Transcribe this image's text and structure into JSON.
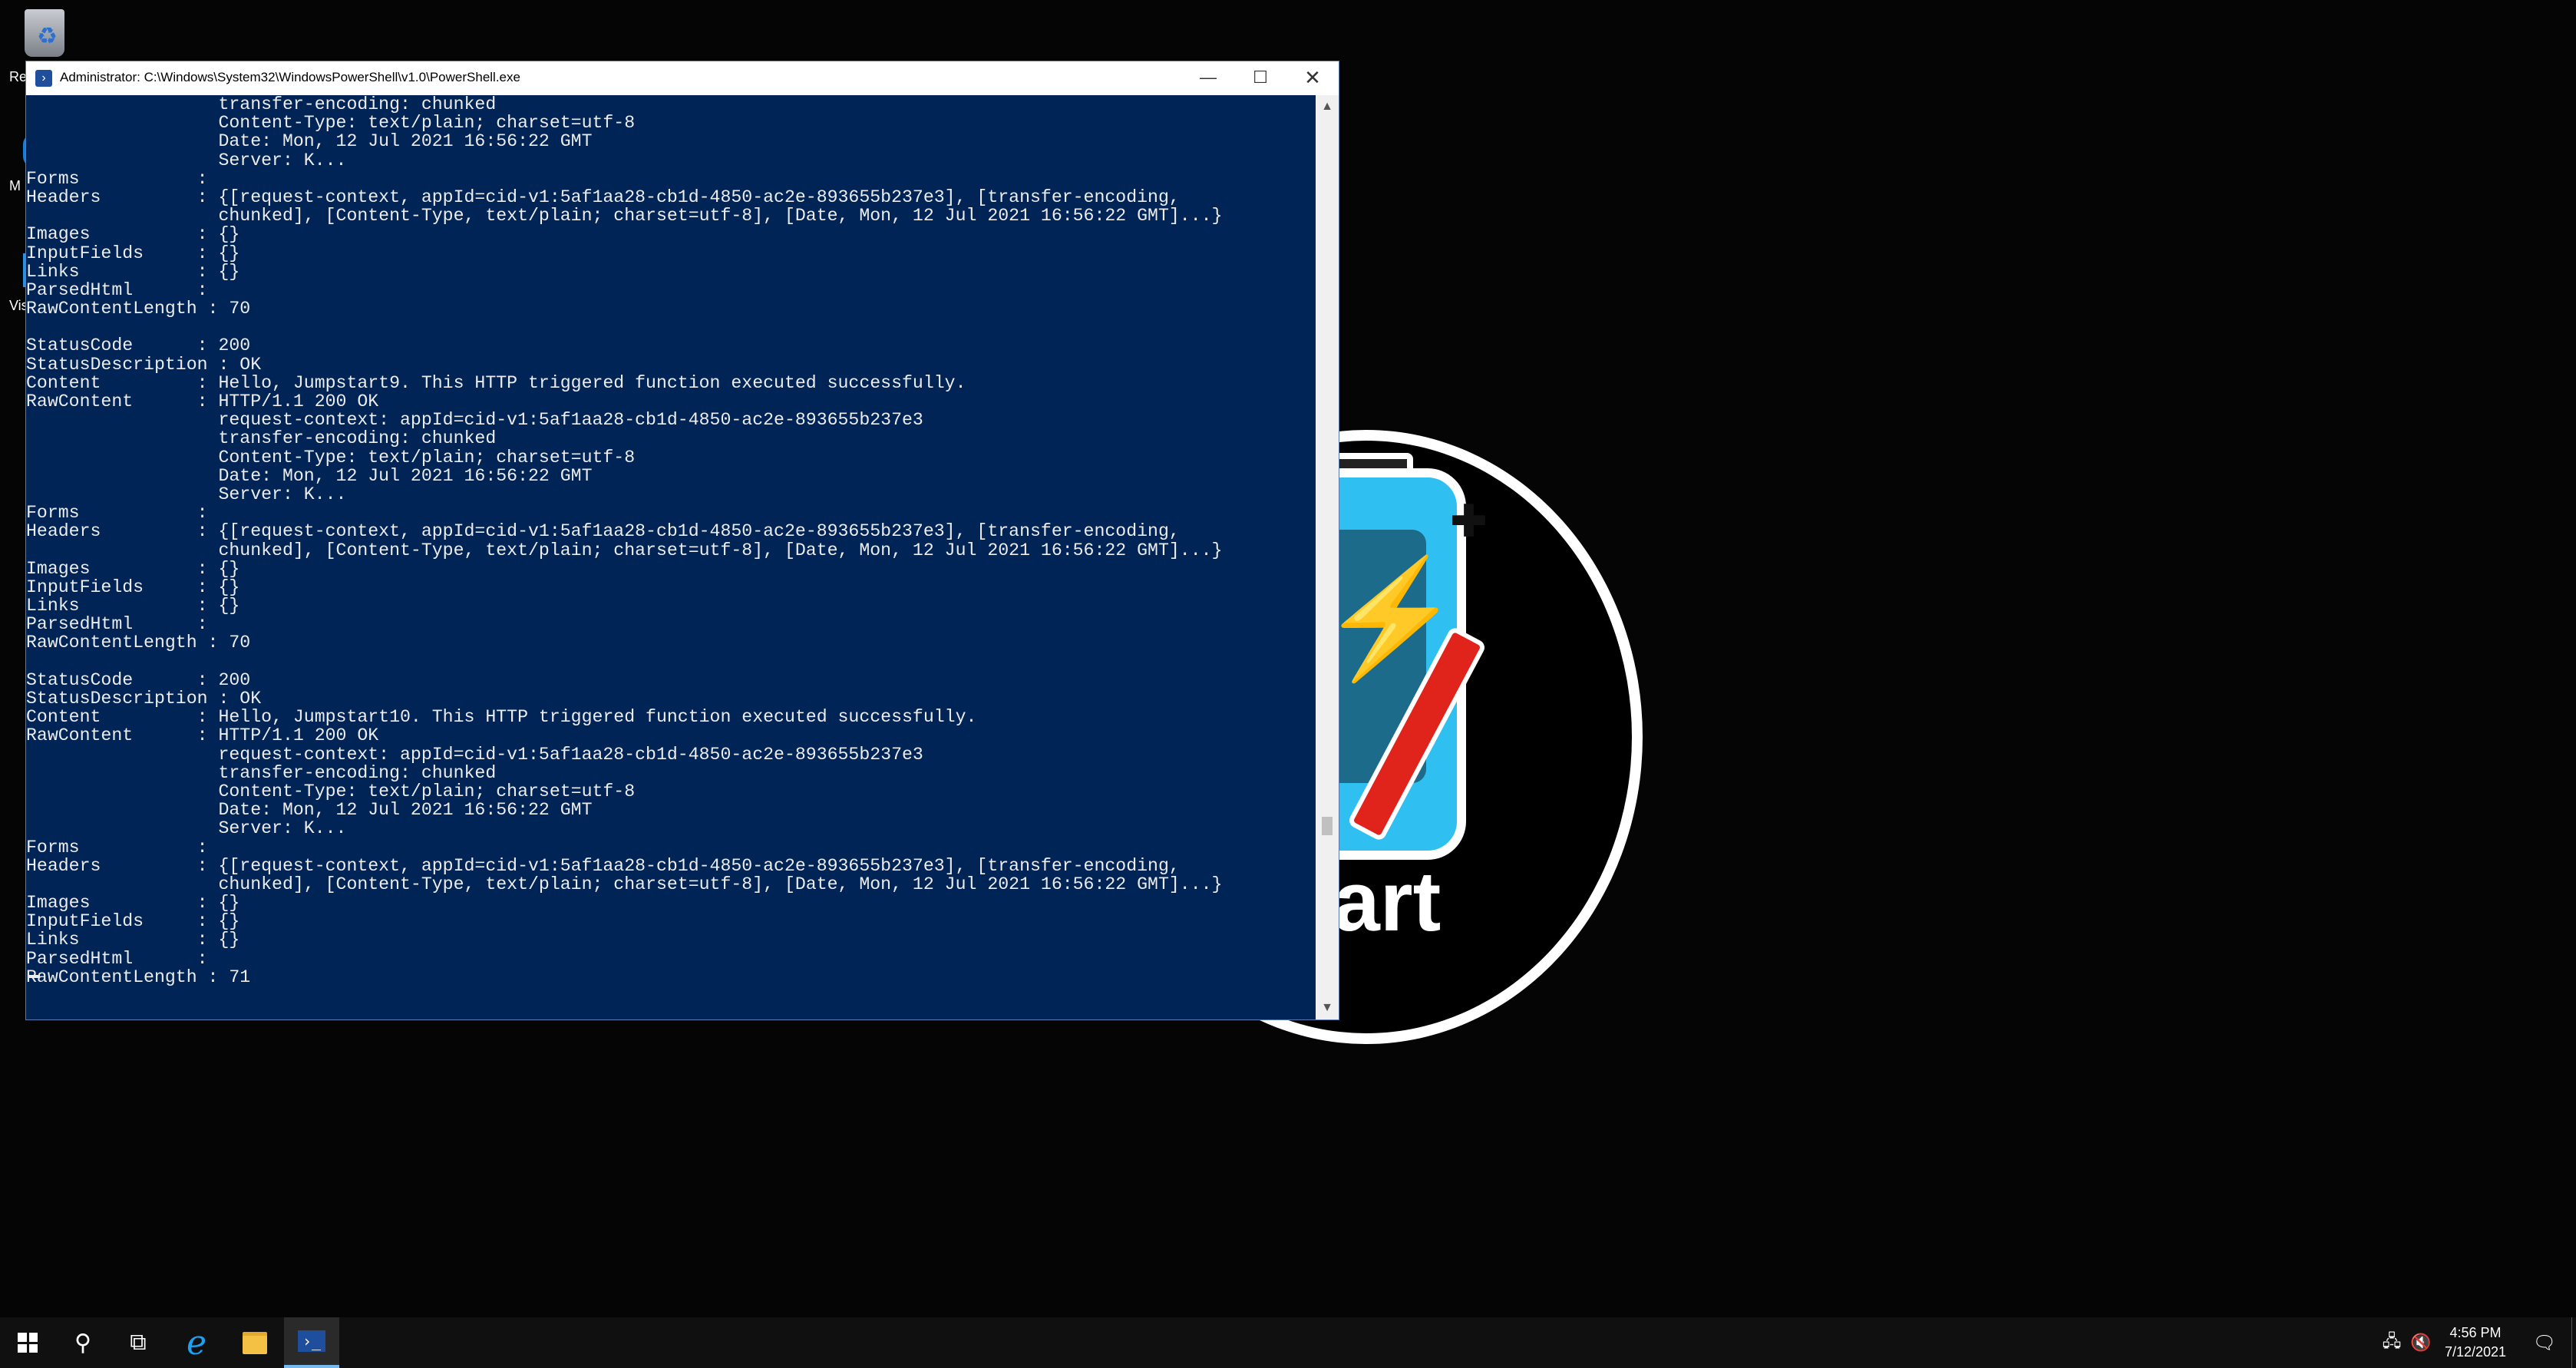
{
  "window": {
    "title": "Administrator: C:\\Windows\\System32\\WindowsPowerShell\\v1.0\\PowerShell.exe",
    "console_lines": [
      "                  transfer-encoding: chunked",
      "                  Content-Type: text/plain; charset=utf-8",
      "                  Date: Mon, 12 Jul 2021 16:56:22 GMT",
      "                  Server: K...",
      "Forms           :",
      "Headers         : {[request-context, appId=cid-v1:5af1aa28-cb1d-4850-ac2e-893655b237e3], [transfer-encoding,",
      "                  chunked], [Content-Type, text/plain; charset=utf-8], [Date, Mon, 12 Jul 2021 16:56:22 GMT]...}",
      "Images          : {}",
      "InputFields     : {}",
      "Links           : {}",
      "ParsedHtml      :",
      "RawContentLength : 70",
      "",
      "StatusCode      : 200",
      "StatusDescription : OK",
      "Content         : Hello, Jumpstart9. This HTTP triggered function executed successfully.",
      "RawContent      : HTTP/1.1 200 OK",
      "                  request-context: appId=cid-v1:5af1aa28-cb1d-4850-ac2e-893655b237e3",
      "                  transfer-encoding: chunked",
      "                  Content-Type: text/plain; charset=utf-8",
      "                  Date: Mon, 12 Jul 2021 16:56:22 GMT",
      "                  Server: K...",
      "Forms           :",
      "Headers         : {[request-context, appId=cid-v1:5af1aa28-cb1d-4850-ac2e-893655b237e3], [transfer-encoding,",
      "                  chunked], [Content-Type, text/plain; charset=utf-8], [Date, Mon, 12 Jul 2021 16:56:22 GMT]...}",
      "Images          : {}",
      "InputFields     : {}",
      "Links           : {}",
      "ParsedHtml      :",
      "RawContentLength : 70",
      "",
      "StatusCode      : 200",
      "StatusDescription : OK",
      "Content         : Hello, Jumpstart10. This HTTP triggered function executed successfully.",
      "RawContent      : HTTP/1.1 200 OK",
      "                  request-context: appId=cid-v1:5af1aa28-cb1d-4850-ac2e-893655b237e3",
      "                  transfer-encoding: chunked",
      "                  Content-Type: text/plain; charset=utf-8",
      "                  Date: Mon, 12 Jul 2021 16:56:22 GMT",
      "                  Server: K...",
      "Forms           :",
      "Headers         : {[request-context, appId=cid-v1:5af1aa28-cb1d-4850-ac2e-893655b237e3], [transfer-encoding,",
      "                  chunked], [Content-Type, text/plain; charset=utf-8], [Date, Mon, 12 Jul 2021 16:56:22 GMT]...}",
      "Images          : {}",
      "InputFields     : {}",
      "Links           : {}",
      "ParsedHtml      :",
      "RawContentLength : 71"
    ]
  },
  "desktop": {
    "recycle_label": "Re",
    "edge_label": "M",
    "vs_label": "Visu"
  },
  "logo": {
    "tag_text": "tart"
  },
  "taskbar": {
    "clock_time": "4:56 PM",
    "clock_date": "7/12/2021"
  },
  "colors": {
    "console_bg": "#012456",
    "console_fg": "#ececec",
    "taskbar_bg": "#101010",
    "accent": "#76b9ed"
  }
}
